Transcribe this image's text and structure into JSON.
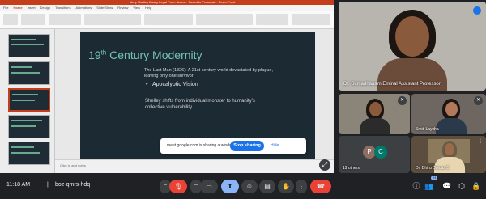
{
  "ppt": {
    "window_title": "Mary Shelley Essay Legal Form Notes .. Saved to Personal .. PowerPoint",
    "tabs": [
      "File",
      "Home",
      "Insert",
      "Design",
      "Transitions",
      "Animations",
      "Slide Show",
      "Review",
      "View",
      "Help"
    ],
    "notes_placeholder": "Click to add notes"
  },
  "slide": {
    "title_num": "19",
    "title_sup": "th",
    "title_rest": " Century Modernity",
    "line1": "The Last Man (1826): A 21st-century world devastated by plague,",
    "line2": "leaving only one survivor",
    "bullet1": "Apocalyptic Vision",
    "bullet2a": "Shelley shifts from individual monster to humanity's",
    "bullet2b": "collective vulnerability"
  },
  "share_banner": {
    "text": "meet.google.com is sharing a window.",
    "stop": "Stop sharing",
    "hide": "Hide"
  },
  "participants": {
    "main": "Dr. Sumadhanam Eminal Assistant Professor",
    "t3": "Smiti Laycha",
    "others_count": "19 others",
    "others_p": "P",
    "others_c": "C",
    "t5": "Dr. Dhiru Dorcas B"
  },
  "bottom": {
    "time": "11:18 AM",
    "separator": "|",
    "meeting_code": "boz-qmrs-hdq",
    "people_badge": "24"
  },
  "colors": {
    "accent": "#1a73e8",
    "end_call": "#ea4335",
    "slide_title": "#73c4b5"
  }
}
